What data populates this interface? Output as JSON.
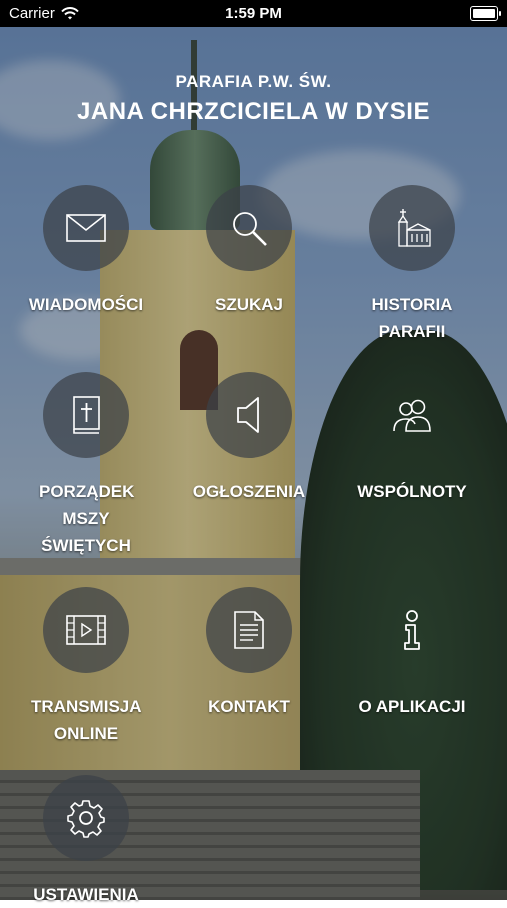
{
  "status_bar": {
    "carrier": "Carrier",
    "time": "1:59 PM"
  },
  "header": {
    "line1": "PARAFIA P.W. ŚW.",
    "line2": "JANA CHRZCICIELA W DYSIE"
  },
  "menu": [
    {
      "label": "WIADOMOŚCI",
      "icon": "envelope-icon"
    },
    {
      "label": "SZUKAJ",
      "icon": "magnifier-icon"
    },
    {
      "label": "HISTORIA PARAFII",
      "icon": "church-icon"
    },
    {
      "label": "PORZĄDEK MSZY ŚWIĘTYCH",
      "icon": "bible-icon"
    },
    {
      "label": "OGŁOSZENIA",
      "icon": "speaker-icon"
    },
    {
      "label": "WSPÓLNOTY",
      "icon": "people-icon"
    },
    {
      "label": "TRANSMISJA ONLINE",
      "icon": "film-icon"
    },
    {
      "label": "KONTAKT",
      "icon": "document-icon"
    },
    {
      "label": "O APLIKACJI",
      "icon": "info-icon"
    },
    {
      "label": "USTAWIENIA",
      "icon": "gear-icon"
    }
  ]
}
